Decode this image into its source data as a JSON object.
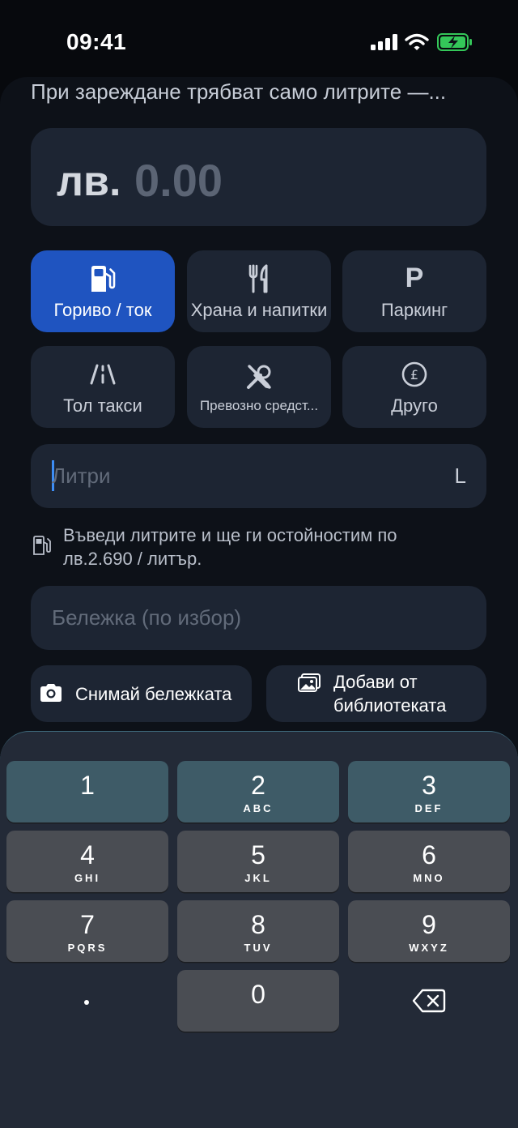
{
  "status": {
    "time": "09:41"
  },
  "hint": "При зареждане трябват само литрите —...",
  "amount": {
    "currency": "лв.",
    "value": "0.00"
  },
  "categories": [
    {
      "label": "Гориво / ток",
      "icon": "fuel-pump-icon",
      "active": true
    },
    {
      "label": "Храна и напитки",
      "icon": "fork-knife-icon",
      "active": false
    },
    {
      "label": "Паркинг",
      "icon": "parking-p-icon",
      "active": false
    },
    {
      "label": "Тол такси",
      "icon": "road-icon",
      "active": false
    },
    {
      "label": "Превозно средст...",
      "icon": "wrench-screwdriver-icon",
      "active": false
    },
    {
      "label": "Друго",
      "icon": "pound-circle-icon",
      "active": false
    }
  ],
  "liters": {
    "placeholder": "Литри",
    "unit": "L"
  },
  "fuel_note": "Въведи литрите и ще ги остойностим по лв.2.690 / литър.",
  "note": {
    "placeholder": "Бележка (по избор)"
  },
  "actions": {
    "camera": "Снимай бележката",
    "library": "Добави от библиотеката"
  },
  "keypad": [
    {
      "digit": "1",
      "letters": ""
    },
    {
      "digit": "2",
      "letters": "ABC"
    },
    {
      "digit": "3",
      "letters": "DEF"
    },
    {
      "digit": "4",
      "letters": "GHI"
    },
    {
      "digit": "5",
      "letters": "JKL"
    },
    {
      "digit": "6",
      "letters": "MNO"
    },
    {
      "digit": "7",
      "letters": "PQRS"
    },
    {
      "digit": "8",
      "letters": "TUV"
    },
    {
      "digit": "9",
      "letters": "WXYZ"
    },
    {
      "digit": "0",
      "letters": ""
    }
  ],
  "colors": {
    "accent": "#1f54c0",
    "card": "#1d2533",
    "battery": "#34c759"
  }
}
